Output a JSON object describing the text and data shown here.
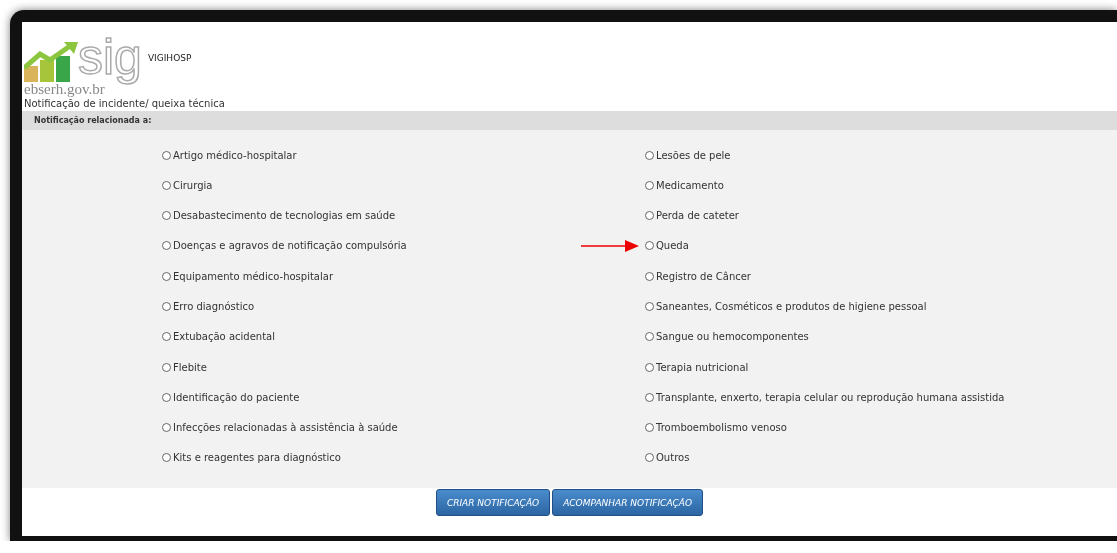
{
  "logo": {
    "name": "sig",
    "domain": "ebserh.gov.br"
  },
  "app_title": "VIGIHOSP",
  "page_title": "Notificação de incidente/ queixa técnica",
  "section": {
    "title": "Notificação relacionada a:"
  },
  "options_left": [
    {
      "label": "Artigo médico-hospitalar",
      "selected": false
    },
    {
      "label": "Cirurgia",
      "selected": false
    },
    {
      "label": "Desabastecimento de tecnologias em saúde",
      "selected": false
    },
    {
      "label": "Doenças e agravos de notificação compulsória",
      "selected": false
    },
    {
      "label": "Equipamento médico-hospitalar",
      "selected": false
    },
    {
      "label": "Erro diagnóstico",
      "selected": false
    },
    {
      "label": "Extubação acidental",
      "selected": false
    },
    {
      "label": "Flebite",
      "selected": false
    },
    {
      "label": "Identificação do paciente",
      "selected": false
    },
    {
      "label": "Infecções relacionadas à assistência à saúde",
      "selected": false
    },
    {
      "label": "Kits e reagentes para diagnóstico",
      "selected": false
    }
  ],
  "options_right": [
    {
      "label": "Lesões de pele",
      "selected": false,
      "marked": false
    },
    {
      "label": "Medicamento",
      "selected": false,
      "marked": false
    },
    {
      "label": "Perda de cateter",
      "selected": false,
      "marked": false
    },
    {
      "label": "Queda",
      "selected": false,
      "marked": true
    },
    {
      "label": "Registro de Câncer",
      "selected": false,
      "marked": false
    },
    {
      "label": "Saneantes, Cosméticos e produtos de higiene pessoal",
      "selected": false,
      "marked": false
    },
    {
      "label": "Sangue ou hemocomponentes",
      "selected": false,
      "marked": false
    },
    {
      "label": "Terapia nutricional",
      "selected": false,
      "marked": false
    },
    {
      "label": "Transplante, enxerto, terapia celular ou reprodução humana assistida",
      "selected": false,
      "marked": false
    },
    {
      "label": "Tromboembolismo venoso",
      "selected": false,
      "marked": false
    },
    {
      "label": "Outros",
      "selected": false,
      "marked": false
    }
  ],
  "buttons": [
    "CRIAR NOTIFICAÇÃO",
    "ACOMPANHAR NOTIFICAÇÃO"
  ]
}
